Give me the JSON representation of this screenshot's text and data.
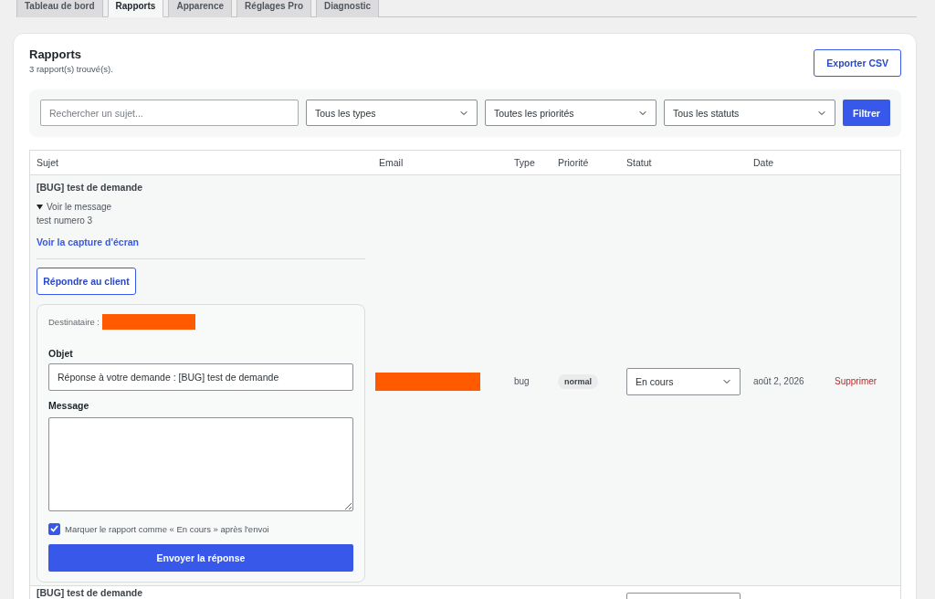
{
  "tabs": [
    {
      "label": "Tableau de bord",
      "selected": false
    },
    {
      "label": "Rapports",
      "selected": true
    },
    {
      "label": "Apparence",
      "selected": false
    },
    {
      "label": "Réglages Pro",
      "selected": false
    },
    {
      "label": "Diagnostic",
      "selected": false
    }
  ],
  "panel": {
    "title": "Rapports",
    "count": "3 rapport(s) trouvé(s).",
    "export_button": "Exporter CSV"
  },
  "filters": {
    "search": {
      "placeholder": "Rechercher un sujet..."
    },
    "selects": [
      {
        "value": "Tous les types"
      },
      {
        "value": "Toutes les priorités"
      },
      {
        "value": "Tous les statuts"
      }
    ],
    "button": "Filtrer"
  },
  "table": {
    "columns": [
      "Sujet",
      "Email",
      "Type",
      "Priorité",
      "Statut",
      "Date"
    ],
    "rows": [
      {
        "subject": "[BUG] test de demande",
        "expanded": true,
        "toggle": "Voir le message",
        "message": "test numero 3",
        "screenshot_link": "Voir la capture d'écran",
        "reply_button": "Répondre au client",
        "reply_form": {
          "recipient_label": "Destinataire :",
          "recipient_redacted": true,
          "subject_label": "Objet",
          "subject_value": "Réponse à votre demande : [BUG] test de demande",
          "message_label": "Message",
          "mark_label": "Marquer le rapport comme « En cours » après l'envoi",
          "mark_checked": true,
          "send_button": "Envoyer la réponse"
        },
        "email_redacted": true,
        "type": "bug",
        "priority": "normal",
        "status": "En cours",
        "date": "août 2, 2026",
        "action": "Supprimer"
      },
      {
        "subject": "[BUG] test de demande"
      }
    ]
  }
}
